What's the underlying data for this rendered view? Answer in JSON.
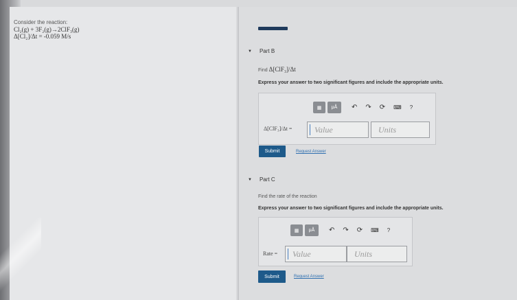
{
  "problem": {
    "consider": "Consider the reaction:",
    "equation": "Cl₂(g) + 3F₂(g)→2ClF₃(g)",
    "given": "Δ[Cl₂]/Δt = -0.059 M/s"
  },
  "part_b": {
    "title": "Part B",
    "find_prefix": "Find",
    "find_expr": "Δ[ClF₃]/Δt",
    "express": "Express your answer to two significant figures and include the appropriate units.",
    "answer_label": "Δ[ClF₃]/Δt =",
    "value_placeholder": "Value",
    "units_placeholder": "Units",
    "submit": "Submit",
    "request_answer": "Request Answer"
  },
  "part_c": {
    "title": "Part C",
    "find": "Find the rate of the reaction",
    "express": "Express your answer to two significant figures and include the appropriate units.",
    "answer_label": "Rate =",
    "value_placeholder": "Value",
    "units_placeholder": "Units",
    "submit": "Submit",
    "request_answer": "Request Answer"
  },
  "toolbar": {
    "template_icon": "template-icon",
    "mu_label": "μÅ",
    "undo_icon": "↶",
    "redo_icon": "↷",
    "reset_icon": "⟳",
    "keyboard_icon": "⌨",
    "help_icon": "?"
  }
}
